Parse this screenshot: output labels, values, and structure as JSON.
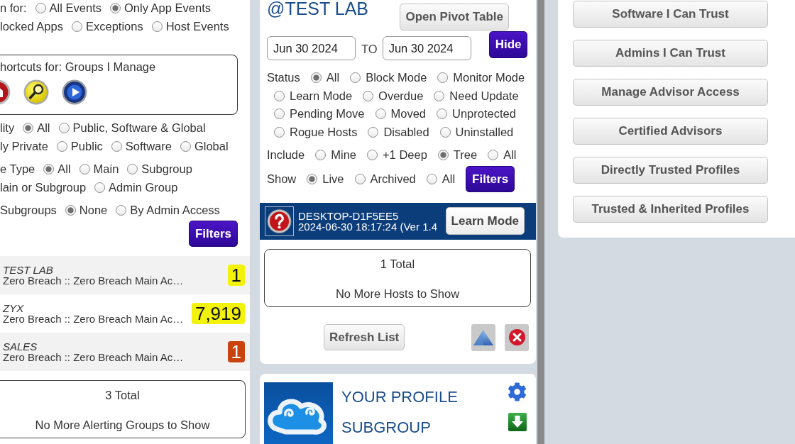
{
  "left_panel": {
    "event_filter": [
      [
        {
          "kind": "label",
          "text": "n for:"
        },
        {
          "kind": "radio",
          "text": "All Events",
          "selected": false
        },
        {
          "kind": "radio",
          "text": "Only App Events",
          "selected": true
        }
      ],
      [
        {
          "kind": "label",
          "text": "locked Apps"
        },
        {
          "kind": "radio",
          "text": "Exceptions",
          "selected": false
        },
        {
          "kind": "radio",
          "text": "Host Events",
          "selected": false
        }
      ]
    ],
    "shortcuts": {
      "title": "hortcuts for: Groups I Manage"
    },
    "group_filters": [
      [
        [
          {
            "kind": "label",
            "text": "lity"
          },
          {
            "kind": "radio",
            "text": "All",
            "selected": true
          },
          {
            "kind": "radio",
            "text": "Public, Software & Global",
            "selected": false
          }
        ],
        [
          {
            "kind": "label",
            "text": "ly Private"
          },
          {
            "kind": "radio",
            "text": "Public",
            "selected": false
          },
          {
            "kind": "radio",
            "text": "Software",
            "selected": false
          },
          {
            "kind": "radio",
            "text": "Global",
            "selected": false
          }
        ]
      ],
      [
        [
          {
            "kind": "label",
            "text": "e Type"
          },
          {
            "kind": "radio",
            "text": "All",
            "selected": true
          },
          {
            "kind": "radio",
            "text": "Main",
            "selected": false
          },
          {
            "kind": "radio",
            "text": "Subgroup",
            "selected": false
          }
        ],
        [
          {
            "kind": "label",
            "text": "lain or Subgroup"
          },
          {
            "kind": "radio",
            "text": "Admin Group",
            "selected": false
          }
        ]
      ],
      [
        [
          {
            "kind": "label",
            "text": "Subgroups"
          },
          {
            "kind": "radio",
            "text": "None",
            "selected": true
          },
          {
            "kind": "radio",
            "text": "By Admin Access",
            "selected": false
          }
        ]
      ]
    ],
    "filters_button": "Filters",
    "alerting_groups": [
      {
        "name": "TEST LAB",
        "path": "Zero Breach :: Zero Breach Main Ac…",
        "count": "1",
        "color": "#f2f20c"
      },
      {
        "name": "ZYX",
        "path": "Zero Breach :: Zero Breach Main Ac…",
        "count": "7,919",
        "color": "#f2f20c"
      },
      {
        "name": "SALES",
        "path": "Zero Breach :: Zero Breach Main Ac…",
        "count": "1",
        "color": "#c9430f"
      }
    ],
    "total": "3 Total",
    "footer": "No More Alerting Groups to Show"
  },
  "hosts_panel": {
    "title": "@TEST LAB",
    "pivot_button": "Open Pivot Table",
    "date_from": "Jun 30 2024",
    "range_label": "TO",
    "date_to": "Jun 30 2024",
    "hide_button": "Hide",
    "filter_groups": [
      [
        [
          {
            "kind": "label",
            "text": "Status"
          },
          {
            "kind": "radio",
            "text": "All",
            "selected": true
          },
          {
            "kind": "radio",
            "text": "Block Mode",
            "selected": false
          },
          {
            "kind": "radio",
            "text": "Monitor Mode",
            "selected": false
          }
        ],
        [
          {
            "kind": "radio",
            "text": "Learn Mode",
            "selected": false
          },
          {
            "kind": "radio",
            "text": "Overdue",
            "selected": false
          },
          {
            "kind": "radio",
            "text": "Need Update",
            "selected": false
          }
        ],
        [
          {
            "kind": "radio",
            "text": "Pending Move",
            "selected": false
          },
          {
            "kind": "radio",
            "text": "Moved",
            "selected": false
          },
          {
            "kind": "radio",
            "text": "Unprotected",
            "selected": false
          }
        ],
        [
          {
            "kind": "radio",
            "text": "Rogue Hosts",
            "selected": false
          },
          {
            "kind": "radio",
            "text": "Disabled",
            "selected": false
          },
          {
            "kind": "radio",
            "text": "Uninstalled",
            "selected": false
          }
        ]
      ],
      [
        [
          {
            "kind": "label",
            "text": "Include"
          },
          {
            "kind": "radio",
            "text": "Mine",
            "selected": false
          },
          {
            "kind": "radio",
            "text": "+1 Deep",
            "selected": false
          },
          {
            "kind": "radio",
            "text": "Tree",
            "selected": true
          },
          {
            "kind": "radio",
            "text": "All",
            "selected": false
          }
        ]
      ],
      [
        [
          {
            "kind": "label",
            "text": "Show"
          },
          {
            "kind": "radio",
            "text": "Live",
            "selected": true
          },
          {
            "kind": "radio",
            "text": "Archived",
            "selected": false
          },
          {
            "kind": "radio",
            "text": "All",
            "selected": false
          },
          {
            "kind": "button",
            "text": "Filters"
          }
        ]
      ]
    ],
    "hosts": [
      {
        "name": "DESKTOP-D1F5EE5",
        "detail": "2024-06-30 18:17:24 (Ver 1.4",
        "action": "Learn Mode"
      }
    ],
    "total": "1 Total",
    "footer": "No More Hosts to Show",
    "refresh_button": "Refresh List"
  },
  "profile_card": {
    "title_lines": [
      "YOUR PROFILE",
      "SUBGROUP"
    ]
  },
  "trust_menu": {
    "buttons": [
      "Software I Can Trust",
      "Admins I Can Trust",
      "Manage Advisor Access",
      "Certified Advisors",
      "Directly Trusted Profiles",
      "Trusted & Inherited Profiles"
    ]
  }
}
